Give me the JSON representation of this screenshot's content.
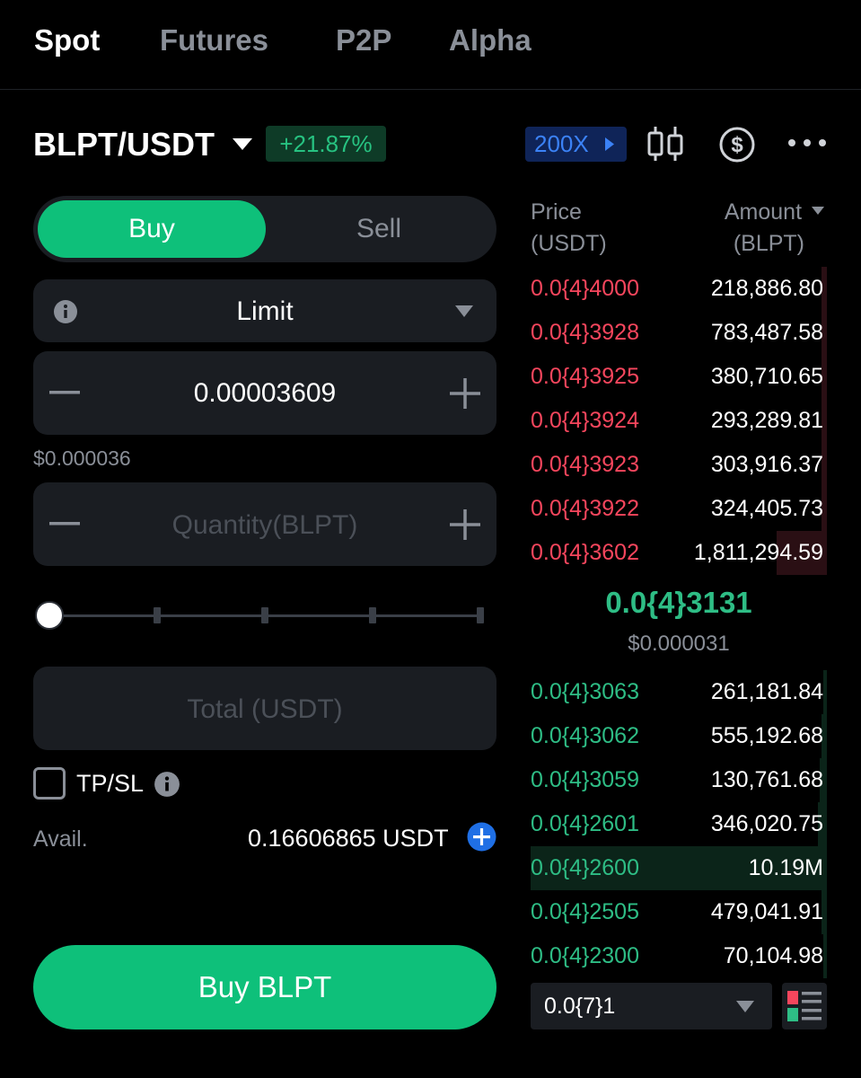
{
  "nav": {
    "tabs": [
      {
        "label": "Spot",
        "active": true
      },
      {
        "label": "Futures",
        "active": false
      },
      {
        "label": "P2P",
        "active": false
      },
      {
        "label": "Alpha",
        "active": false
      }
    ]
  },
  "header": {
    "pair": "BLPT/USDT",
    "change": "+21.87%",
    "leverage": "200X",
    "icons": [
      "candlestick-chart-icon",
      "dollar-circle-icon",
      "more-options-icon"
    ]
  },
  "order_form": {
    "buy_label": "Buy",
    "sell_label": "Sell",
    "order_type": "Limit",
    "price_value": "0.00003609",
    "price_usd": "$0.000036",
    "quantity_placeholder": "Quantity(BLPT)",
    "total_placeholder": "Total (USDT)",
    "slider_percent": 0,
    "tpsl_label": "TP/SL",
    "tpsl_checked": false,
    "avail_label": "Avail.",
    "avail_value": "0.16606865 USDT",
    "submit_label": "Buy BLPT"
  },
  "order_book": {
    "price_header": "Price",
    "price_unit": "(USDT)",
    "amount_header": "Amount",
    "amount_unit": "(BLPT)",
    "asks": [
      {
        "price": "0.0{4}4000",
        "amount": "218,886.80"
      },
      {
        "price": "0.0{4}3928",
        "amount": "783,487.58"
      },
      {
        "price": "0.0{4}3925",
        "amount": "380,710.65"
      },
      {
        "price": "0.0{4}3924",
        "amount": "293,289.81"
      },
      {
        "price": "0.0{4}3923",
        "amount": "303,916.37"
      },
      {
        "price": "0.0{4}3922",
        "amount": "324,405.73"
      },
      {
        "price": "0.0{4}3602",
        "amount": "1,811,294.59"
      }
    ],
    "last_price": "0.0{4}3131",
    "last_price_usd": "$0.000031",
    "bids": [
      {
        "price": "0.0{4}3063",
        "amount": "261,181.84"
      },
      {
        "price": "0.0{4}3062",
        "amount": "555,192.68"
      },
      {
        "price": "0.0{4}3059",
        "amount": "130,761.68"
      },
      {
        "price": "0.0{4}2601",
        "amount": "346,020.75"
      },
      {
        "price": "0.0{4}2600",
        "amount": "10.19M"
      },
      {
        "price": "0.0{4}2505",
        "amount": "479,041.91"
      },
      {
        "price": "0.0{4}2300",
        "amount": "70,104.98"
      }
    ],
    "precision": "0.0{7}1"
  },
  "colors": {
    "buy_green": "#0ec07a",
    "ask_red": "#f6465d",
    "bid_green": "#2ebd85",
    "leverage_blue": "#3b82f6"
  }
}
